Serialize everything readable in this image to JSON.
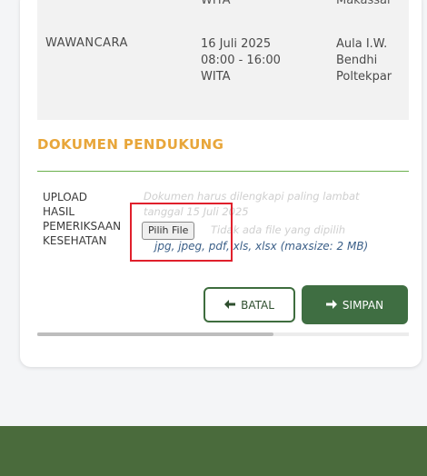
{
  "schedule": {
    "prev_row": {
      "date_tail": "WITA",
      "place_tail": "Makassar"
    },
    "row": {
      "label": "WAWANCARA",
      "date_lines": [
        "16 Juli 2025",
        "08:00 - 16:00",
        "WITA"
      ],
      "place_lines": [
        "Aula I.W.",
        "Bendhi",
        "Poltekpar"
      ]
    }
  },
  "section": {
    "title": "DOKUMEN PENDUKUNG"
  },
  "upload": {
    "label_lines": [
      "UPLOAD",
      "HASIL",
      "PEMERIKSAAN",
      "KESEHATAN"
    ],
    "hint_line1": "Dokumen harus dilengkapi paling lambat",
    "hint_line2": "tanggal 15 Juli 2025",
    "file_button": "Pilih File",
    "no_file_text": "Tidak ada file yang dipilih",
    "formats": "jpg, jpeg, pdf, xls, xlsx (maxsize: 2 MB)"
  },
  "actions": {
    "cancel_label": "BATAL",
    "save_label": "SIMPAN"
  },
  "icons": {
    "cancel": "arrow-left-icon",
    "save": "arrow-right-icon"
  },
  "colors": {
    "accent_title": "#e8a63a",
    "primary_green": "#3f6e42",
    "footer": "#4a6b3c",
    "highlight": "#e0202c"
  }
}
